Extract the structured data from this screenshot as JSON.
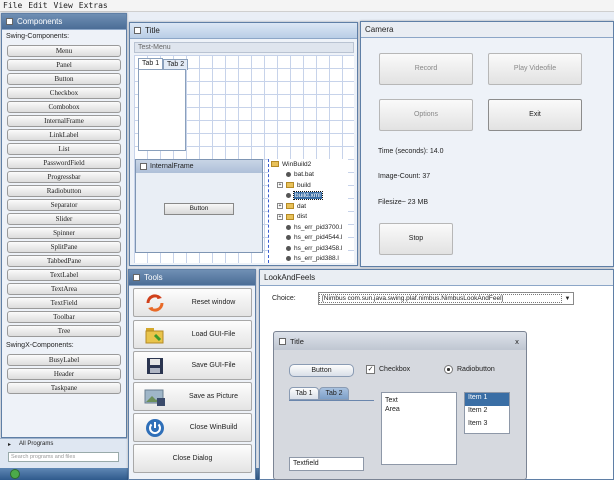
{
  "menubar": {
    "items": [
      "File",
      "Edit",
      "View",
      "Extras"
    ]
  },
  "components": {
    "title": "Components",
    "swing_heading": "Swing-Components:",
    "swing": [
      "Menu",
      "Panel",
      "Button",
      "Checkbox",
      "Combobox",
      "InternalFrame",
      "LinkLabel",
      "List",
      "PasswordField",
      "Progressbar",
      "Radiobutton",
      "Separator",
      "Slider",
      "Spinner",
      "SplitPane",
      "TabbedPane",
      "TextLabel",
      "TextArea",
      "TextField",
      "Toolbar",
      "Tree"
    ],
    "swingx_heading": "SwingX-Components:",
    "swingx": [
      "BusyLabel",
      "Header",
      "Taskpane"
    ]
  },
  "start": {
    "programs": "All Programs",
    "search": "Search programs and files"
  },
  "title_window": {
    "title": "Title",
    "menu_label": "Test-Menu",
    "tabs": [
      "Tab 1",
      "Tab 2"
    ],
    "internal_frame": "InternalFrame",
    "button": "Button",
    "tree": [
      "WinBuild2",
      "bat.bat",
      "build",
      "build.xml",
      "dat",
      "dist",
      "hs_err_pid3700.l",
      "hs_err_pid4544.l",
      "hs_err_pid3458.l",
      "hs_err_pid388.l"
    ]
  },
  "camera": {
    "title": "Camera",
    "record": "Record",
    "play": "Play Videofile",
    "options": "Options",
    "exit": "Exit",
    "time": "Time (seconds): 14.0",
    "count": "Image-Count: 37",
    "filesize": "Filesize~ 23 MB",
    "stop": "Stop"
  },
  "tools": {
    "title": "Tools",
    "items": [
      {
        "label": "Reset window",
        "icon": "reset-icon"
      },
      {
        "label": "Load GUI-File",
        "icon": "folder-icon"
      },
      {
        "label": "Save GUI-File",
        "icon": "floppy-icon"
      },
      {
        "label": "Save as Picture",
        "icon": "picture-icon"
      },
      {
        "label": "Close WinBuild",
        "icon": "power-icon"
      },
      {
        "label": "Close Dialog",
        "icon": ""
      }
    ]
  },
  "laf": {
    "title": "LookAndFeels",
    "choice_label": "Choice:",
    "choice_value": "[Nimbus com.sun.java.swing.plaf.nimbus.NimbusLookAndFeel]"
  },
  "nimbus": {
    "title": "Title",
    "close": "x",
    "button": "Button",
    "checkbox": "Checkbox",
    "radio": "Radiobutton",
    "tabs": [
      "Tab 1",
      "Tab 2"
    ],
    "textarea": "Text\nArea",
    "list": [
      "Item 1",
      "Item 2",
      "Item 3"
    ],
    "textfield": "Textfield"
  },
  "colors": {
    "accent": "#3d6fa8",
    "selection": "#3a6ea5",
    "titlebar": "#c9d9ee"
  }
}
